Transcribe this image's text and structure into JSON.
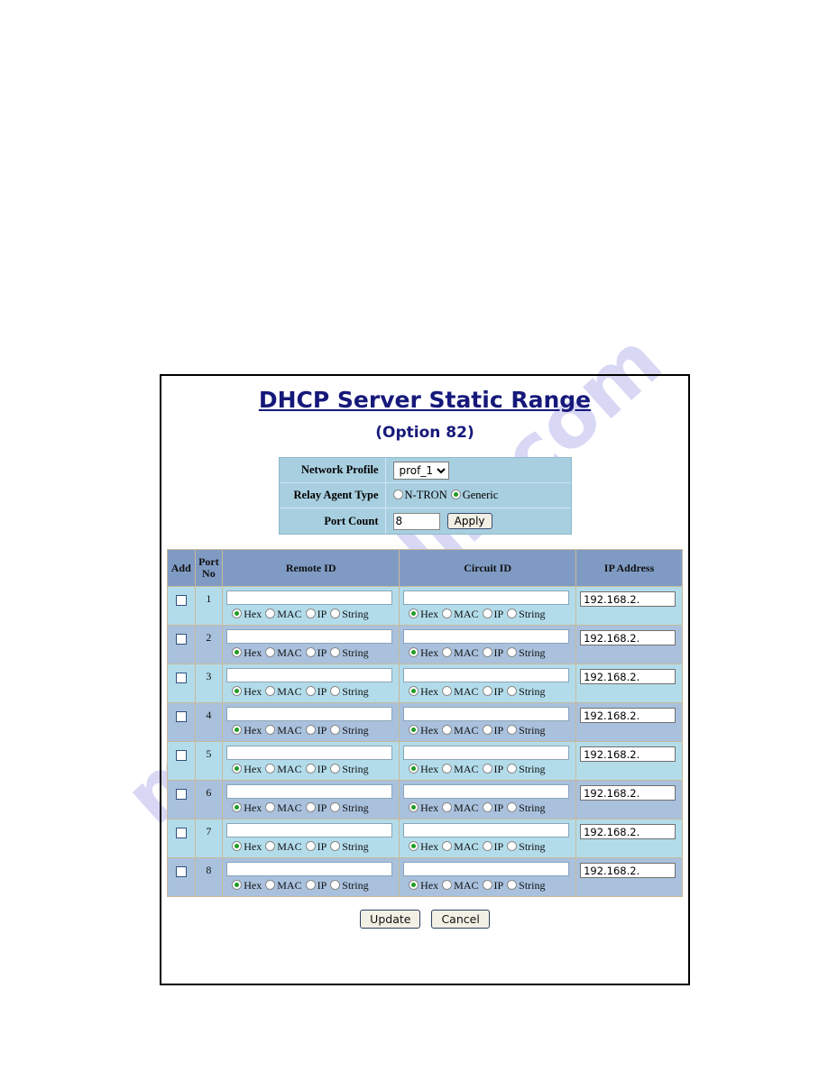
{
  "watermark": {
    "text": "manualslib.com"
  },
  "page": {
    "title": "DHCP Server Static Range",
    "subtitle": "(Option 82)"
  },
  "settings": {
    "network_profile": {
      "label": "Network Profile",
      "selected": "prof_1",
      "options": [
        "prof_1"
      ]
    },
    "relay_agent_type": {
      "label": "Relay Agent Type",
      "options": [
        {
          "label": "N-TRON",
          "selected": false
        },
        {
          "label": "Generic",
          "selected": true
        }
      ]
    },
    "port_count": {
      "label": "Port Count",
      "value": "8",
      "apply_label": "Apply"
    }
  },
  "table": {
    "headers": {
      "add": "Add",
      "port_no": "Port\nNo",
      "port_no_line1": "Port",
      "port_no_line2": "No",
      "remote_id": "Remote ID",
      "circuit_id": "Circuit ID",
      "ip_address": "IP Address"
    },
    "format_options": [
      "Hex",
      "MAC",
      "IP",
      "String"
    ],
    "default_format": "Hex",
    "rows": [
      {
        "port": "1",
        "add_checked": false,
        "remote_id": "",
        "remote_format": "Hex",
        "circuit_id": "",
        "circuit_format": "Hex",
        "ip": "192.168.2."
      },
      {
        "port": "2",
        "add_checked": false,
        "remote_id": "",
        "remote_format": "Hex",
        "circuit_id": "",
        "circuit_format": "Hex",
        "ip": "192.168.2."
      },
      {
        "port": "3",
        "add_checked": false,
        "remote_id": "",
        "remote_format": "Hex",
        "circuit_id": "",
        "circuit_format": "Hex",
        "ip": "192.168.2."
      },
      {
        "port": "4",
        "add_checked": false,
        "remote_id": "",
        "remote_format": "Hex",
        "circuit_id": "",
        "circuit_format": "Hex",
        "ip": "192.168.2."
      },
      {
        "port": "5",
        "add_checked": false,
        "remote_id": "",
        "remote_format": "Hex",
        "circuit_id": "",
        "circuit_format": "Hex",
        "ip": "192.168.2."
      },
      {
        "port": "6",
        "add_checked": false,
        "remote_id": "",
        "remote_format": "Hex",
        "circuit_id": "",
        "circuit_format": "Hex",
        "ip": "192.168.2."
      },
      {
        "port": "7",
        "add_checked": false,
        "remote_id": "",
        "remote_format": "Hex",
        "circuit_id": "",
        "circuit_format": "Hex",
        "ip": "192.168.2."
      },
      {
        "port": "8",
        "add_checked": false,
        "remote_id": "",
        "remote_format": "Hex",
        "circuit_id": "",
        "circuit_format": "Hex",
        "ip": "192.168.2."
      }
    ]
  },
  "footer": {
    "update_label": "Update",
    "cancel_label": "Cancel"
  },
  "colors": {
    "title": "#16197a",
    "header_row": "#7f9bc4",
    "row_a": "#b3dcea",
    "row_b": "#a9c1dd",
    "settings_panel": "#a8cfe0",
    "radio_selected": "#1f9b23"
  }
}
